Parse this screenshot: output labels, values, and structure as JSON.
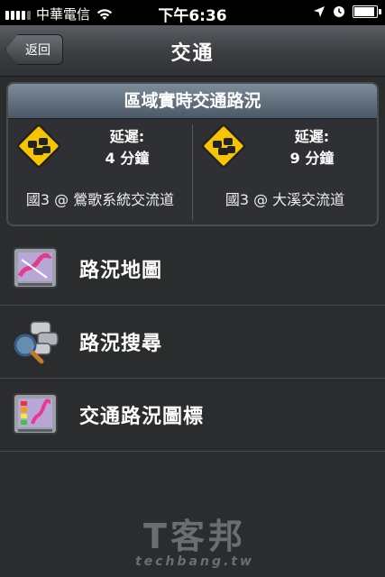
{
  "status_bar": {
    "carrier": "中華電信",
    "time": "下午6:36",
    "battery_level": 0.85
  },
  "nav": {
    "back_label": "返回",
    "title": "交通"
  },
  "traffic_card": {
    "header": "區域實時交通路況",
    "items": [
      {
        "delay_label": "延遲:",
        "delay_value": "4 分鐘",
        "road": "國3 @ 鶯歌系統交流道"
      },
      {
        "delay_label": "延遲:",
        "delay_value": "9 分鐘",
        "road": "國3 @ 大溪交流道"
      }
    ]
  },
  "menu": {
    "items": [
      {
        "label": "路況地圖",
        "icon": "traffic-map-icon"
      },
      {
        "label": "路況搜尋",
        "icon": "traffic-search-icon"
      },
      {
        "label": "交通路況圖標",
        "icon": "traffic-legend-icon"
      }
    ]
  },
  "watermark": {
    "logo": "T客邦",
    "url": "techbang.tw"
  },
  "colors": {
    "background": "#2b2c2e",
    "card_header": "#5f6d7a",
    "warning_yellow": "#f6c400"
  }
}
